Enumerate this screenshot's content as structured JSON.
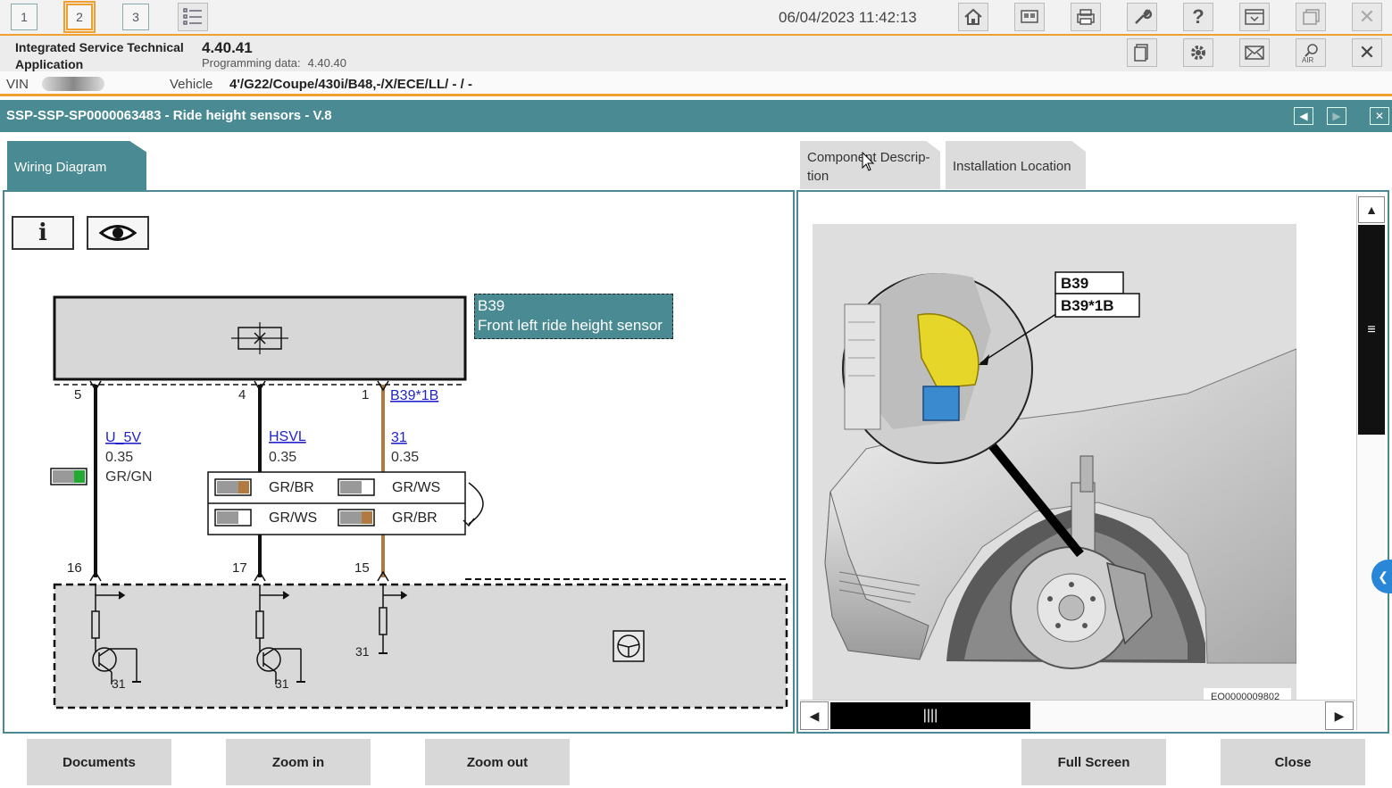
{
  "toolbar": {
    "tabs": [
      "1",
      "2",
      "3"
    ],
    "datetime": "06/04/2023 11:42:13"
  },
  "info": {
    "app_name_line1": "Integrated Service Technical",
    "app_name_line2": "Application",
    "version": "4.40.41",
    "programming_label": "Programming data:",
    "programming_value": "4.40.40"
  },
  "vehicle_bar": {
    "vin_label": "VIN",
    "vehicle_label": "Vehicle",
    "vehicle_value": "4'/G22/Coupe/430i/B48,-/X/ECE/LL/ - / -"
  },
  "document": {
    "title": "SSP-SSP-SP0000063483 - Ride height sensors - V.8"
  },
  "tabs": {
    "wiring": "Wiring Diagram",
    "component_line1": "Component Descrip-",
    "component_line2": "tion",
    "installation": "Installation Location"
  },
  "wiring": {
    "component_id": "B39",
    "component_name": "Front left ride height sensor",
    "connector_link": "B39*1B",
    "pins_top": [
      "5",
      "4",
      "1"
    ],
    "pins_bottom": [
      "16",
      "17",
      "15"
    ],
    "signals": [
      {
        "name": "U_5V",
        "size": "0.35",
        "color": "GR/GN"
      },
      {
        "name": "HSVL",
        "size": "0.35"
      },
      {
        "name": "31",
        "size": "0.35"
      }
    ],
    "color_table": [
      [
        "GR/BR",
        "GR/WS"
      ],
      [
        "GR/WS",
        "GR/BR"
      ]
    ],
    "ground_labels": [
      "31",
      "31",
      "31"
    ]
  },
  "install_image": {
    "callout_1": "B39",
    "callout_2": "B39*1B",
    "image_code": "EO0000009802"
  },
  "buttons": {
    "documents": "Documents",
    "zoom_in": "Zoom in",
    "zoom_out": "Zoom out",
    "full_screen": "Full Screen",
    "close": "Close"
  },
  "colors": {
    "accent": "#f0a030",
    "header_teal": "#4a8a92",
    "wire_brown": "#b07a40",
    "highlight_box": "#4a8a92"
  }
}
